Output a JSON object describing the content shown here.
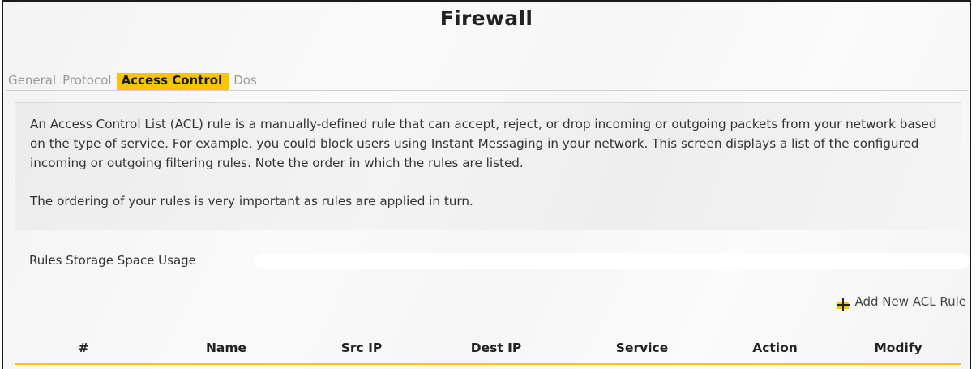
{
  "page": {
    "title": "Firewall"
  },
  "tabs": [
    {
      "label": "General",
      "active": false
    },
    {
      "label": "Protocol",
      "active": false
    },
    {
      "label": "Access Control",
      "active": true
    },
    {
      "label": "Dos",
      "active": false
    }
  ],
  "description": {
    "paragraph1": "An Access Control List (ACL) rule is a manually-defined rule that can accept, reject, or drop incoming or outgoing packets from your network based on the type of service. For example, you could block users using Instant Messaging in your network. This screen displays a list of the configured incoming or outgoing filtering rules. Note the order in which the rules are listed.",
    "paragraph2": "The ordering of your rules is very important as rules are applied in turn."
  },
  "storage": {
    "label": "Rules Storage Space Usage",
    "usage_percent": 0
  },
  "actions": {
    "add_rule_label": "Add New ACL Rule",
    "add_rule_icon": "plus-icon"
  },
  "table": {
    "columns": [
      "#",
      "Name",
      "Src IP",
      "Dest IP",
      "Service",
      "Action",
      "Modify"
    ],
    "rows": []
  },
  "colors": {
    "accent": "#f7c600",
    "text": "#333333",
    "inactive_tab": "#9a9a9a"
  }
}
